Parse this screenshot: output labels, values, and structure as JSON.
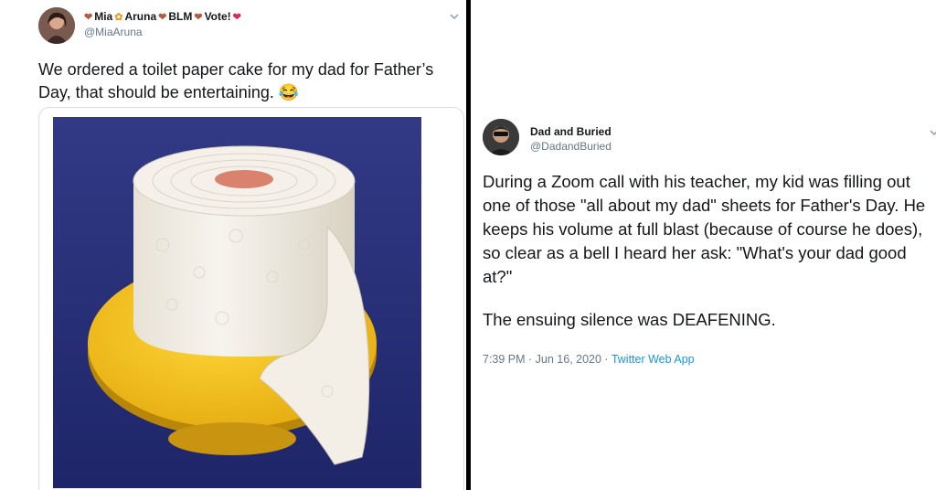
{
  "left_tweet": {
    "display_name": "Mia",
    "name_part_2": "Aruna",
    "name_part_3": "BLM",
    "name_part_4": "Vote!",
    "handle": "@MiaAruna",
    "text": "We ordered a toilet paper cake for my dad for Father’s Day, that should be entertaining. 😂"
  },
  "right_tweet": {
    "display_name": "Dad and Buried",
    "handle": "@DadandBuried",
    "text_paragraph_1": "During a Zoom call with his teacher, my kid was filling out one of those \"all about my dad\" sheets for Father's Day. He keeps his volume at full blast (because of course he does), so clear as a bell I heard her ask: \"What's your dad good at?\"",
    "text_paragraph_2": "The ensuing silence was DEAFENING.",
    "timestamp": "7:39 PM · Jun 16, 2020 · ",
    "source": "Twitter Web App"
  },
  "colors": {
    "photo_background": "#29327a",
    "cake_stand": "#f3c21a",
    "link_blue": "#1b95e0",
    "secondary_text": "#657786"
  },
  "icons": [
    "heart-icon",
    "sunflower-icon",
    "chevron-down-icon"
  ]
}
